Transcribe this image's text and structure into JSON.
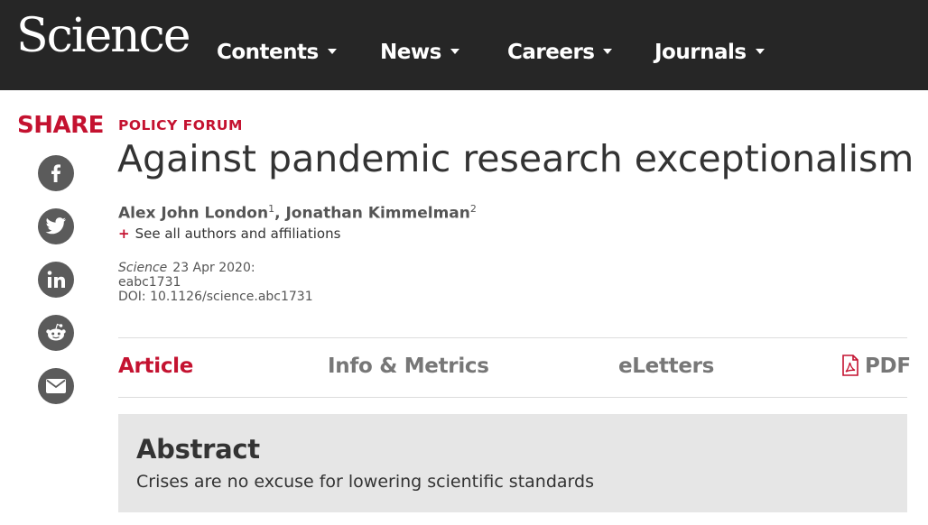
{
  "header": {
    "logo": "Science",
    "nav": [
      {
        "label": "Contents"
      },
      {
        "label": "News"
      },
      {
        "label": "Careers"
      },
      {
        "label": "Journals"
      }
    ]
  },
  "share": {
    "title": "SHARE",
    "buttons": [
      "facebook-icon",
      "twitter-icon",
      "linkedin-icon",
      "reddit-icon",
      "email-icon"
    ]
  },
  "article": {
    "section": "POLICY FORUM",
    "title": "Against pandemic research exceptionalism",
    "authors": [
      {
        "name": "Alex John London",
        "sup": "1"
      },
      {
        "name": "Jonathan Kimmelman",
        "sup": "2"
      }
    ],
    "author_separator": ",",
    "see_all": "See all authors and affiliations",
    "see_all_prefix": "+",
    "journal": "Science",
    "date": "23 Apr 2020:",
    "article_id": "eabc1731",
    "doi": "DOI: 10.1126/science.abc1731"
  },
  "tabs": [
    {
      "label": "Article",
      "active": true
    },
    {
      "label": "Info & Metrics",
      "active": false
    },
    {
      "label": "eLetters",
      "active": false
    },
    {
      "label": "PDF",
      "active": false
    }
  ],
  "abstract": {
    "heading": "Abstract",
    "text": "Crises are no excuse for lowering scientific standards"
  },
  "colors": {
    "accent": "#c41230",
    "header_bg": "#262626",
    "share_icon_bg": "#5b5b5b",
    "abstract_bg": "#e6e6e6"
  }
}
